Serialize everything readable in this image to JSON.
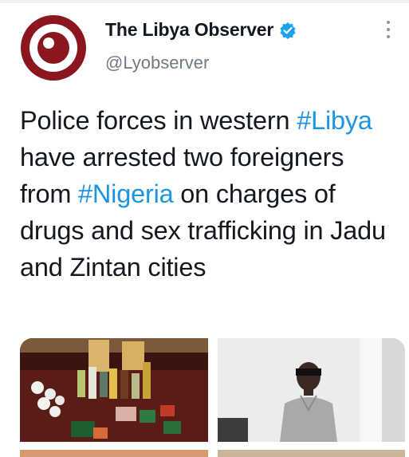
{
  "account": {
    "display_name": "The Libya Observer",
    "handle": "@Lyobserver",
    "verified": true
  },
  "tweet": {
    "segments": [
      {
        "text": "Police forces in western ",
        "type": "text"
      },
      {
        "text": "#Libya",
        "type": "hashtag"
      },
      {
        "text": " have arrested two foreigners from ",
        "type": "text"
      },
      {
        "text": "#Nigeria",
        "type": "hashtag"
      },
      {
        "text": " on charges of drugs and sex trafficking in Jadu and Zintan cities",
        "type": "text"
      }
    ]
  },
  "icons": {
    "avatar": "libya-observer-logo",
    "verified": "verified-badge-icon",
    "more": "more-options-icon"
  },
  "colors": {
    "hashtag": "#1b95e0",
    "logo_red": "#8c1620",
    "verified_blue": "#1da1f2"
  },
  "media": {
    "image_1": "seized items on table",
    "image_2": "detained man"
  }
}
